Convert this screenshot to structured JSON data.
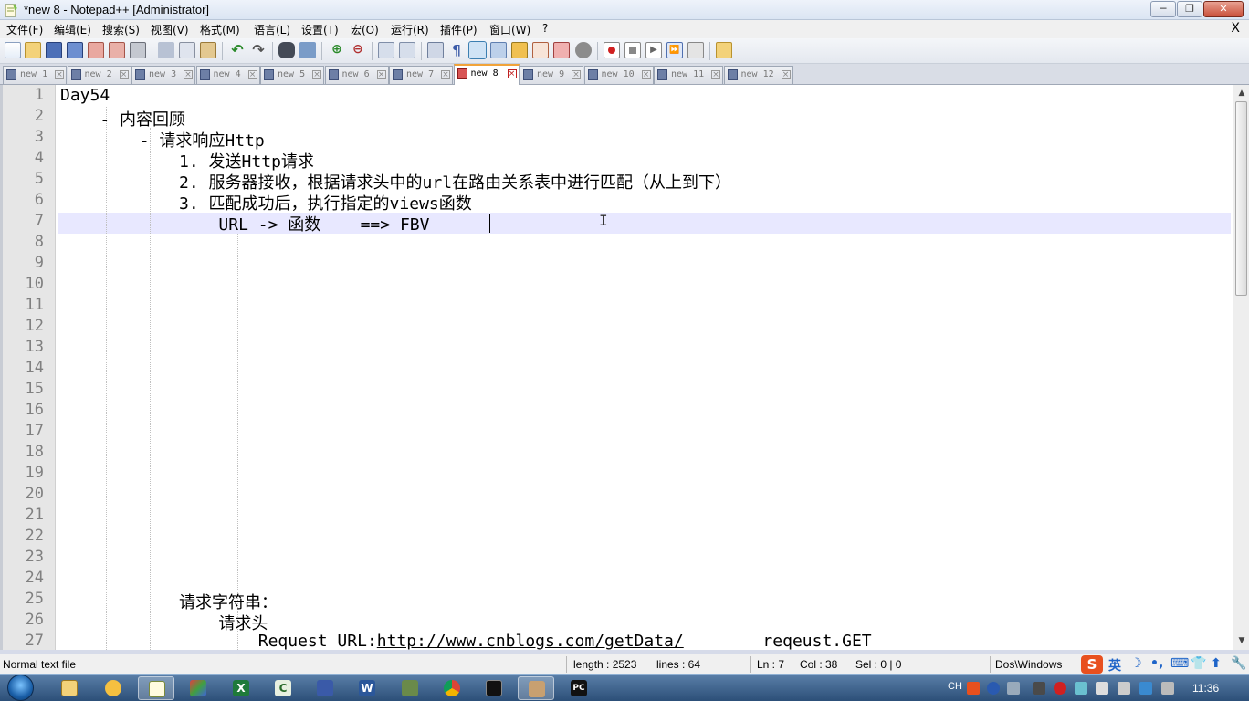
{
  "window": {
    "title": "*new 8 - Notepad++ [Administrator]",
    "minimize": "─",
    "maximize": "❐",
    "close": "✕"
  },
  "menu": {
    "items": [
      "文件(F)",
      "编辑(E)",
      "搜索(S)",
      "视图(V)",
      "格式(M)",
      "语言(L)",
      "设置(T)",
      "宏(O)",
      "运行(R)",
      "插件(P)",
      "窗口(W)",
      "?"
    ],
    "close": "X"
  },
  "tabs": [
    {
      "label": "new 1",
      "active": false
    },
    {
      "label": "new 2",
      "active": false
    },
    {
      "label": "new 3",
      "active": false
    },
    {
      "label": "new 4",
      "active": false
    },
    {
      "label": "new 5",
      "active": false
    },
    {
      "label": "new 6",
      "active": false
    },
    {
      "label": "new 7",
      "active": false
    },
    {
      "label": "new 8",
      "active": true
    },
    {
      "label": "new 9",
      "active": false
    },
    {
      "label": "new 10",
      "active": false
    },
    {
      "label": "new 11",
      "active": false
    },
    {
      "label": "new 12",
      "active": false
    }
  ],
  "editor": {
    "line_numbers": [
      "1",
      "2",
      "3",
      "4",
      "5",
      "6",
      "7",
      "8",
      "9",
      "10",
      "11",
      "12",
      "13",
      "14",
      "15",
      "16",
      "17",
      "18",
      "19",
      "20",
      "21",
      "22",
      "23",
      "24",
      "25",
      "26",
      "27"
    ],
    "current_line": 7,
    "lines": [
      "Day54",
      "    - 内容回顾",
      "        - 请求响应Http",
      "            1. 发送Http请求",
      "            2. 服务器接收，根据请求头中的url在路由关系表中进行匹配（从上到下）",
      "            3. 匹配成功后，执行指定的views函数",
      "                URL -> 函数    ==> FBV",
      "",
      "",
      "",
      "",
      "",
      "",
      "",
      "",
      "",
      "",
      "",
      "",
      "",
      "",
      "",
      "",
      "",
      "            请求字符串：",
      "                请求头",
      "                    Request URL:"
    ],
    "line27_link": "http://www.cnblogs.com/getData/",
    "line27_tail": "        reqeust.GET"
  },
  "status": {
    "file_type": "Normal text file",
    "length": "length : 2523",
    "lines": "lines : 64",
    "ln": "Ln : 7",
    "col": "Col : 38",
    "sel": "Sel : 0 | 0",
    "eol": "Dos\\Windows",
    "ime_lang": "英"
  },
  "taskbar": {
    "lang": "CH",
    "clock": "11:36"
  },
  "colors": {
    "active_tab_accent": "#f1a33a",
    "current_line": "#e8e8ff",
    "taskbar": "#2c4f78"
  }
}
